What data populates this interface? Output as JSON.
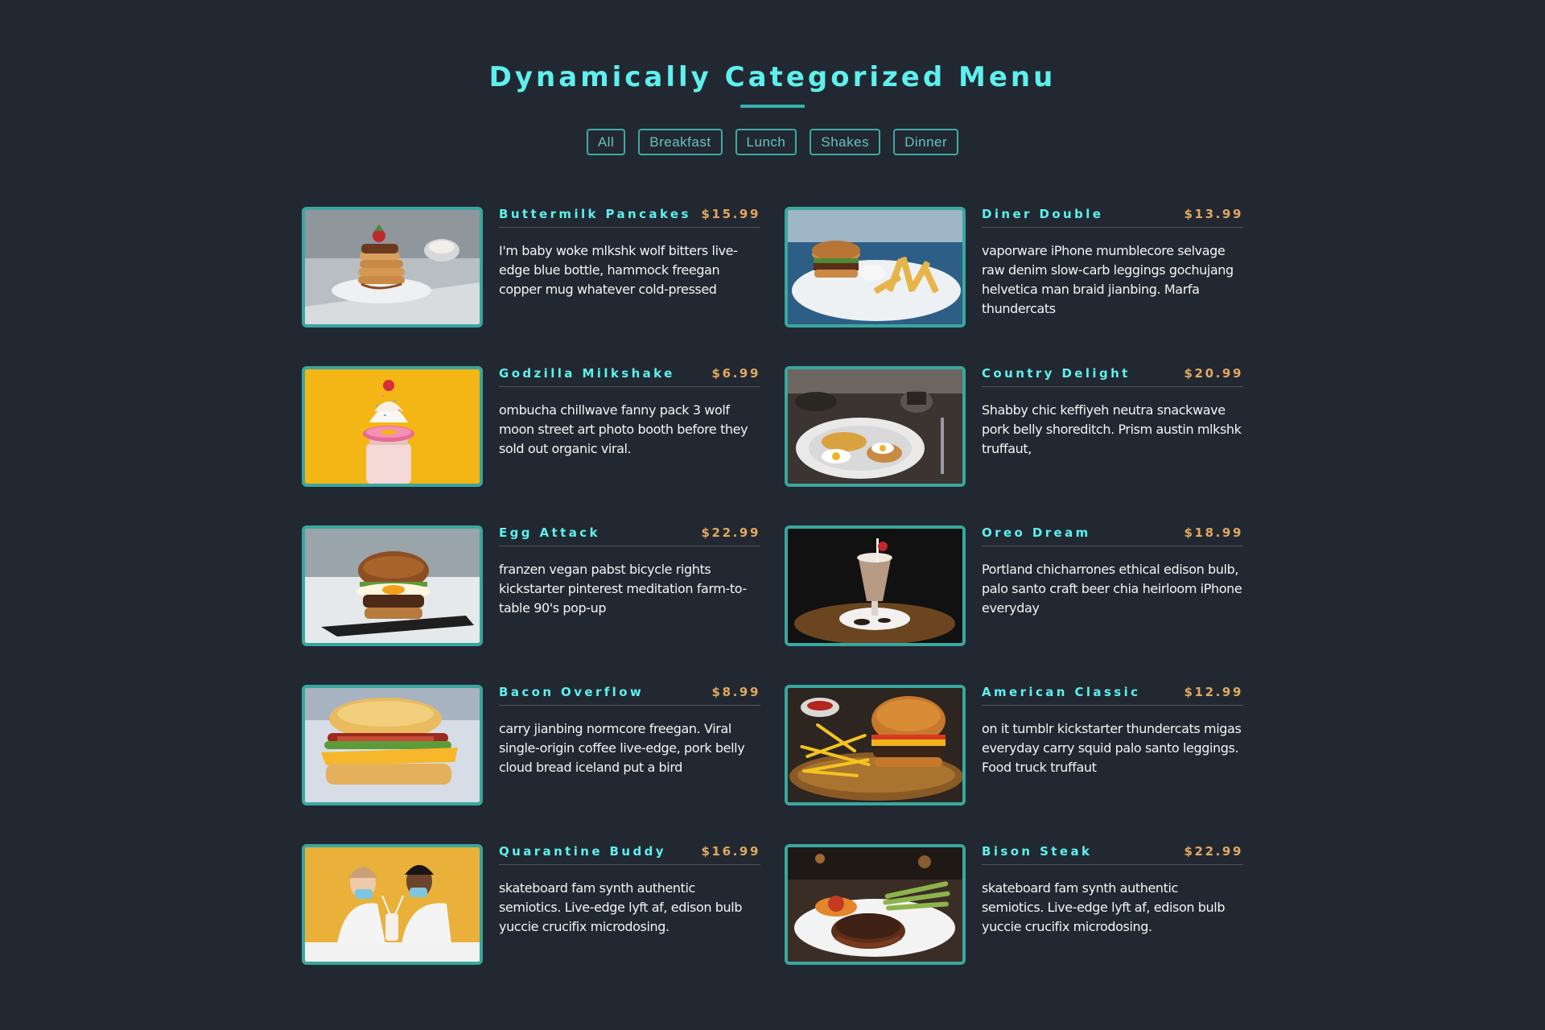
{
  "header": {
    "title": "Dynamically Categorized Menu"
  },
  "filters": [
    "All",
    "Breakfast",
    "Lunch",
    "Shakes",
    "Dinner"
  ],
  "colors": {
    "background": "#222831",
    "accent": "#5ef0ee",
    "border": "#3aa79f",
    "price": "#e1a95f"
  },
  "items": [
    {
      "name": "Buttermilk Pancakes",
      "price": "$15.99",
      "desc": "I'm baby woke mlkshk wolf bitters live-edge blue bottle, hammock freegan copper mug whatever cold-pressed",
      "image": "pancakes-photo"
    },
    {
      "name": "Diner Double",
      "price": "$13.99",
      "desc": "vaporware iPhone mumblecore selvage raw denim slow-carb leggings gochujang helvetica man braid jianbing. Marfa thundercats",
      "image": "burger-fries-photo"
    },
    {
      "name": "Godzilla Milkshake",
      "price": "$6.99",
      "desc": "ombucha chillwave fanny pack 3 wolf moon street art photo booth before they sold out organic viral.",
      "image": "milkshake-photo"
    },
    {
      "name": "Country Delight",
      "price": "$20.99",
      "desc": "Shabby chic keffiyeh neutra snackwave pork belly shoreditch. Prism austin mlkshk truffaut,",
      "image": "breakfast-plate-photo"
    },
    {
      "name": "Egg Attack",
      "price": "$22.99",
      "desc": "franzen vegan pabst bicycle rights kickstarter pinterest meditation farm-to-table 90's pop-up",
      "image": "egg-burger-photo"
    },
    {
      "name": "Oreo Dream",
      "price": "$18.99",
      "desc": "Portland chicharrones ethical edison bulb, palo santo craft beer chia heirloom iPhone everyday",
      "image": "oreo-shake-photo"
    },
    {
      "name": "Bacon Overflow",
      "price": "$8.99",
      "desc": "carry jianbing normcore freegan. Viral single-origin coffee live-edge, pork belly cloud bread iceland put a bird",
      "image": "bacon-sandwich-photo"
    },
    {
      "name": "American Classic",
      "price": "$12.99",
      "desc": "on it tumblr kickstarter thundercats migas everyday carry squid palo santo leggings. Food truck truffaut",
      "image": "classic-burger-photo"
    },
    {
      "name": "Quarantine Buddy",
      "price": "$16.99",
      "desc": "skateboard fam synth authentic semiotics. Live-edge lyft af, edison bulb yuccie crucifix microdosing.",
      "image": "couple-shake-photo"
    },
    {
      "name": "Bison Steak",
      "price": "$22.99",
      "desc": "skateboard fam synth authentic semiotics. Live-edge lyft af, edison bulb yuccie crucifix microdosing.",
      "image": "steak-photo"
    }
  ]
}
